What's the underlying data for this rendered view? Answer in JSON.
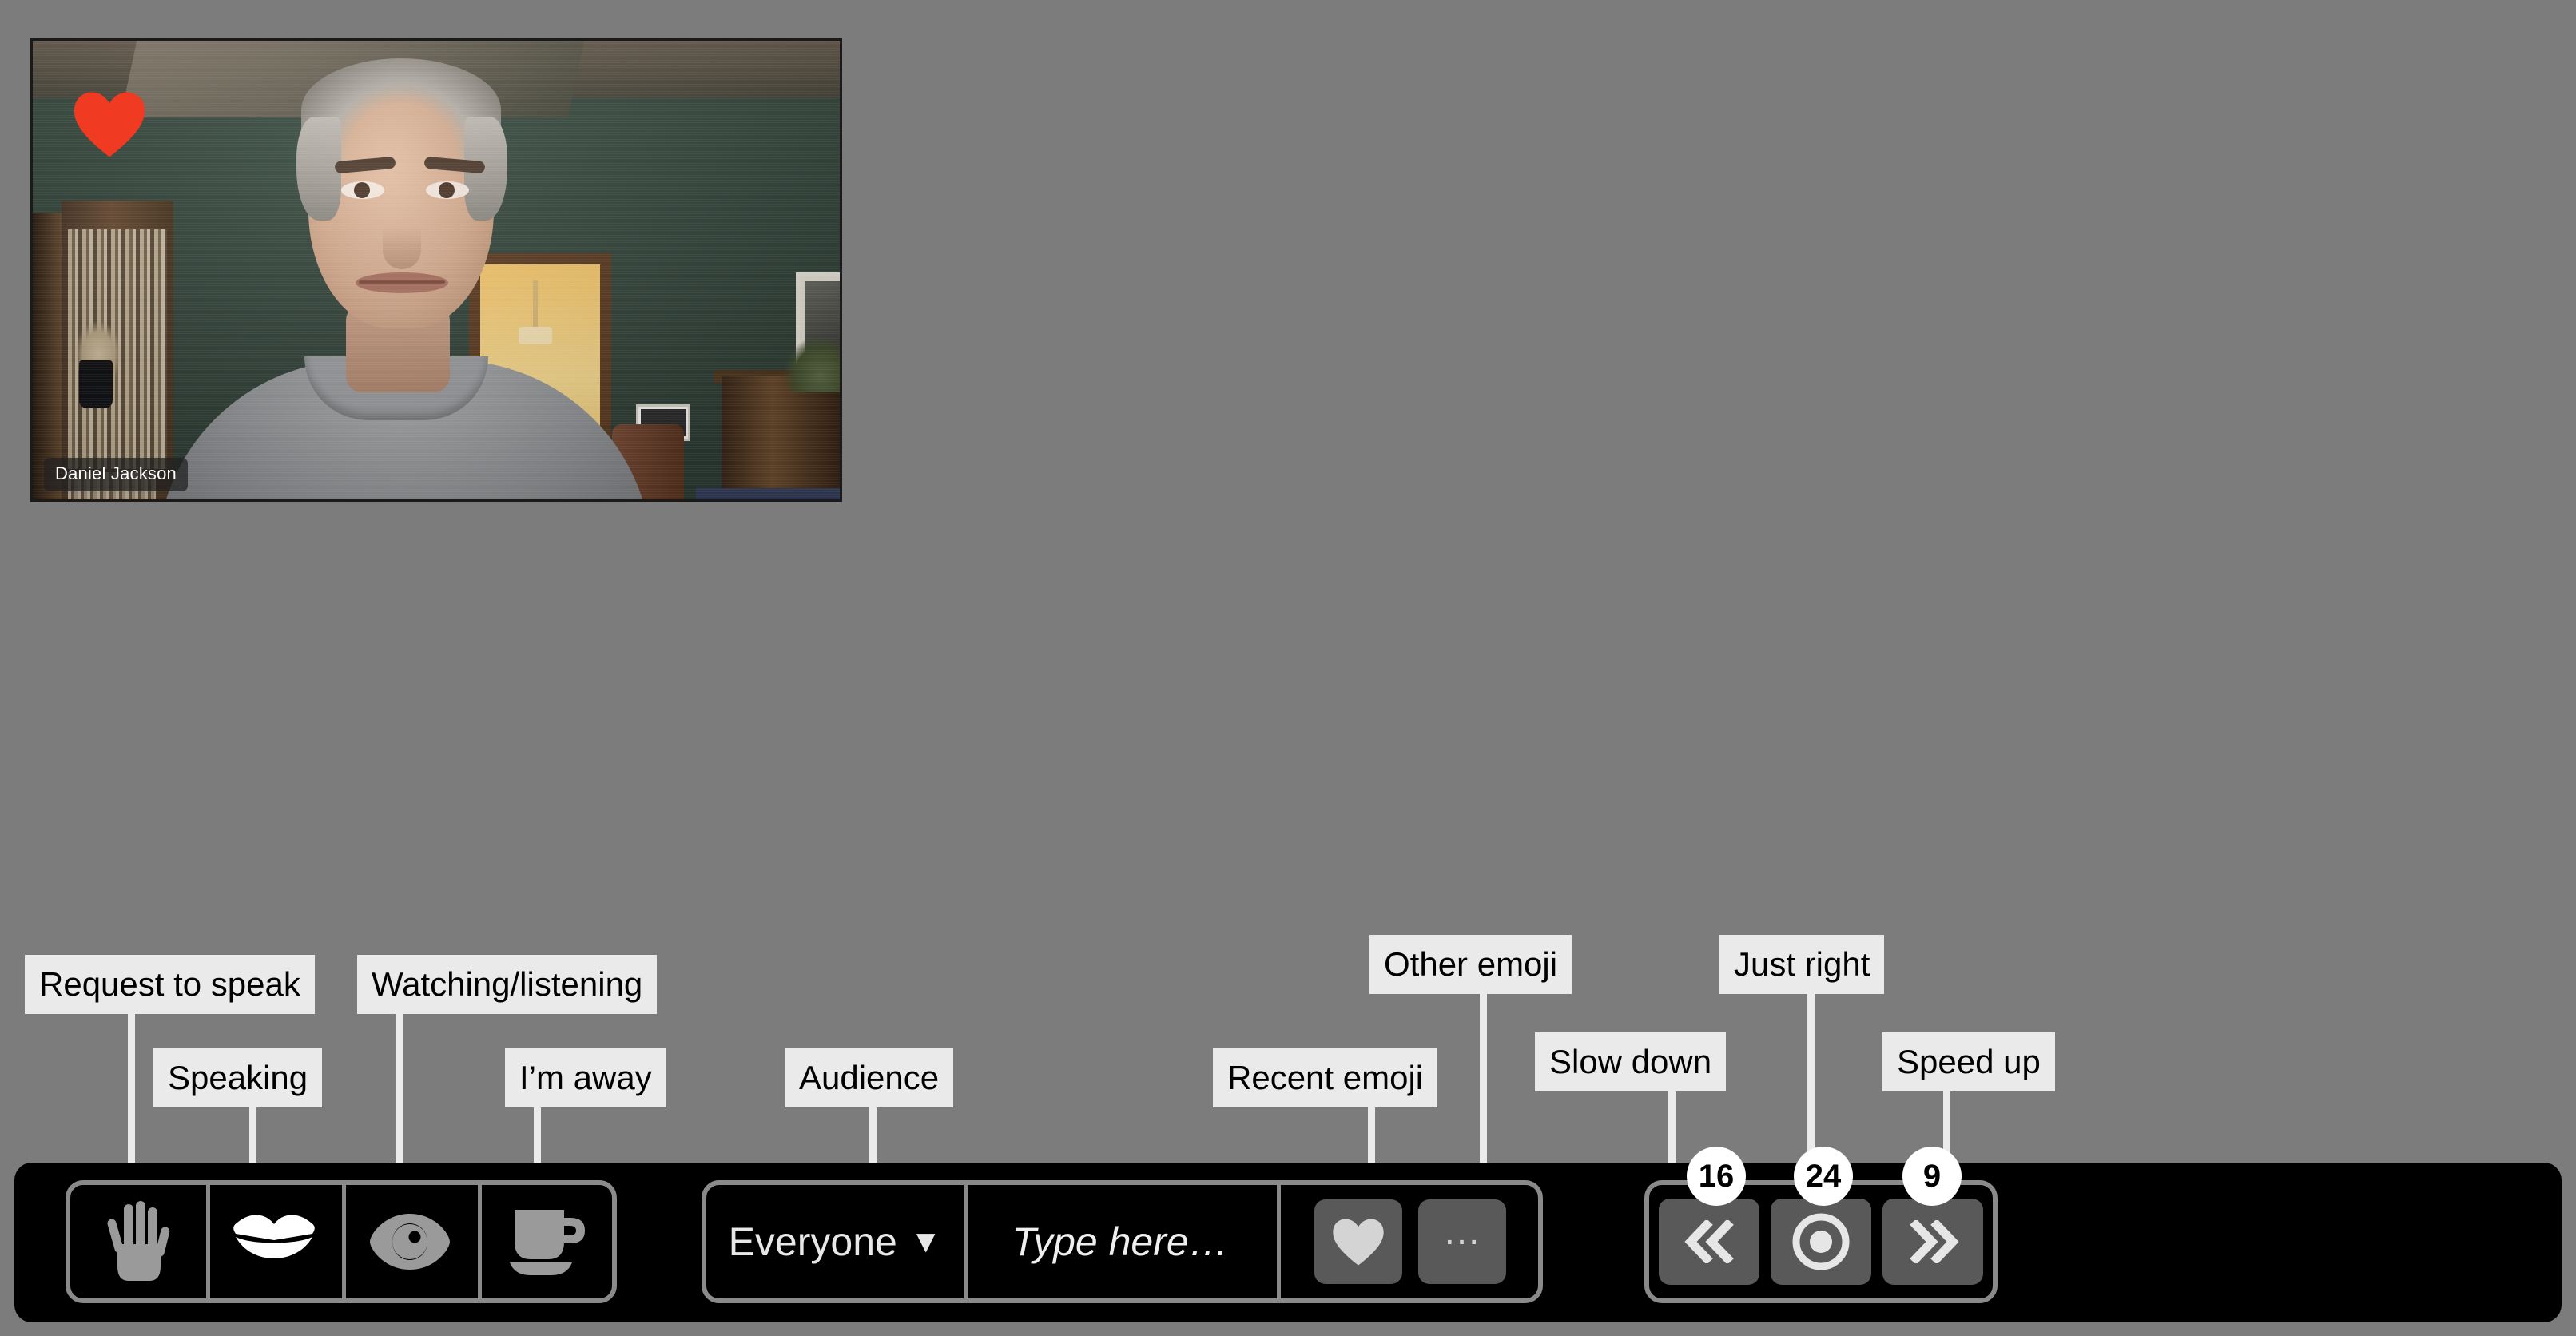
{
  "app": {
    "background_color": "#7c7c7c",
    "toolbar_color": "#000000",
    "accent_heart_color": "#f03a22"
  },
  "video_tile": {
    "participant_name": "Daniel Jackson",
    "reaction_icon": "heart-icon",
    "reaction_color": "#f03a22"
  },
  "callouts": [
    {
      "id": "request-to-speak",
      "label": "Request to speak"
    },
    {
      "id": "speaking",
      "label": "Speaking"
    },
    {
      "id": "watching-listening",
      "label": "Watching/listening"
    },
    {
      "id": "im-away",
      "label": "I’m away"
    },
    {
      "id": "audience",
      "label": "Audience"
    },
    {
      "id": "recent-emoji",
      "label": "Recent emoji"
    },
    {
      "id": "other-emoji",
      "label": "Other emoji"
    },
    {
      "id": "slow-down",
      "label": "Slow down"
    },
    {
      "id": "just-right",
      "label": "Just right"
    },
    {
      "id": "speed-up",
      "label": "Speed up"
    }
  ],
  "toolbar": {
    "status_group": {
      "buttons": [
        {
          "id": "request-to-speak",
          "icon": "raised-hand-icon",
          "active": false
        },
        {
          "id": "speaking",
          "icon": "lips-icon",
          "active": true
        },
        {
          "id": "watching-listening",
          "icon": "eye-icon",
          "active": false
        },
        {
          "id": "im-away",
          "icon": "coffee-cup-icon",
          "active": false
        }
      ]
    },
    "message_group": {
      "audience_select": {
        "value": "Everyone",
        "caret": "▼"
      },
      "message_input": {
        "value": "",
        "placeholder": "Type here…"
      },
      "recent_emoji_button": {
        "icon": "heart-icon"
      },
      "other_emoji_button": {
        "label": "…"
      }
    },
    "pacing_group": {
      "buttons": [
        {
          "id": "slow-down",
          "icon": "double-chevron-left-icon",
          "count": "16"
        },
        {
          "id": "just-right",
          "icon": "target-dot-icon",
          "count": "24"
        },
        {
          "id": "speed-up",
          "icon": "double-chevron-right-icon",
          "count": "9"
        }
      ]
    }
  }
}
